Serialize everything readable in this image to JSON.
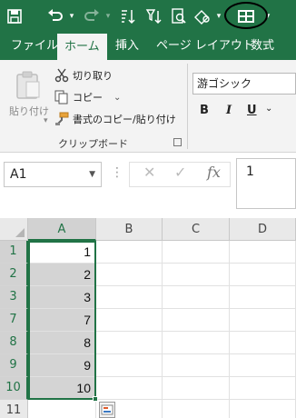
{
  "ribbon_tabs": {
    "file": "ファイル",
    "home": "ホーム",
    "insert": "挿入",
    "page_layout": "ページ レイアウト",
    "formulas": "数式"
  },
  "clipboard": {
    "paste": "貼り付け",
    "cut": "切り取り",
    "copy": "コピー",
    "copy_dropdown": "⌄",
    "format_painter": "書式のコピー/貼り付け",
    "group_label": "クリップボード"
  },
  "font": {
    "name": "游ゴシック",
    "bold": "B",
    "italic": "I",
    "underline": "U",
    "underline_dropdown": "⌄"
  },
  "formula_bar": {
    "name_box": "A1",
    "name_box_dropdown": "▼",
    "dots": "⋮",
    "cancel": "✕",
    "enter": "✓",
    "fx": "fx",
    "content": "1"
  },
  "sheet": {
    "columns": [
      "A",
      "B",
      "C",
      "D"
    ],
    "rows": [
      {
        "num": "1",
        "a": "1"
      },
      {
        "num": "2",
        "a": "2"
      },
      {
        "num": "3",
        "a": "3"
      },
      {
        "num": "7",
        "a": "7"
      },
      {
        "num": "8",
        "a": "8"
      },
      {
        "num": "9",
        "a": "9"
      },
      {
        "num": "10",
        "a": "10"
      },
      {
        "num": "11",
        "a": ""
      }
    ]
  },
  "colors": {
    "accent": "#217346",
    "ribbon_bg": "#f3f3f3",
    "selection": "#d4d4d4"
  }
}
